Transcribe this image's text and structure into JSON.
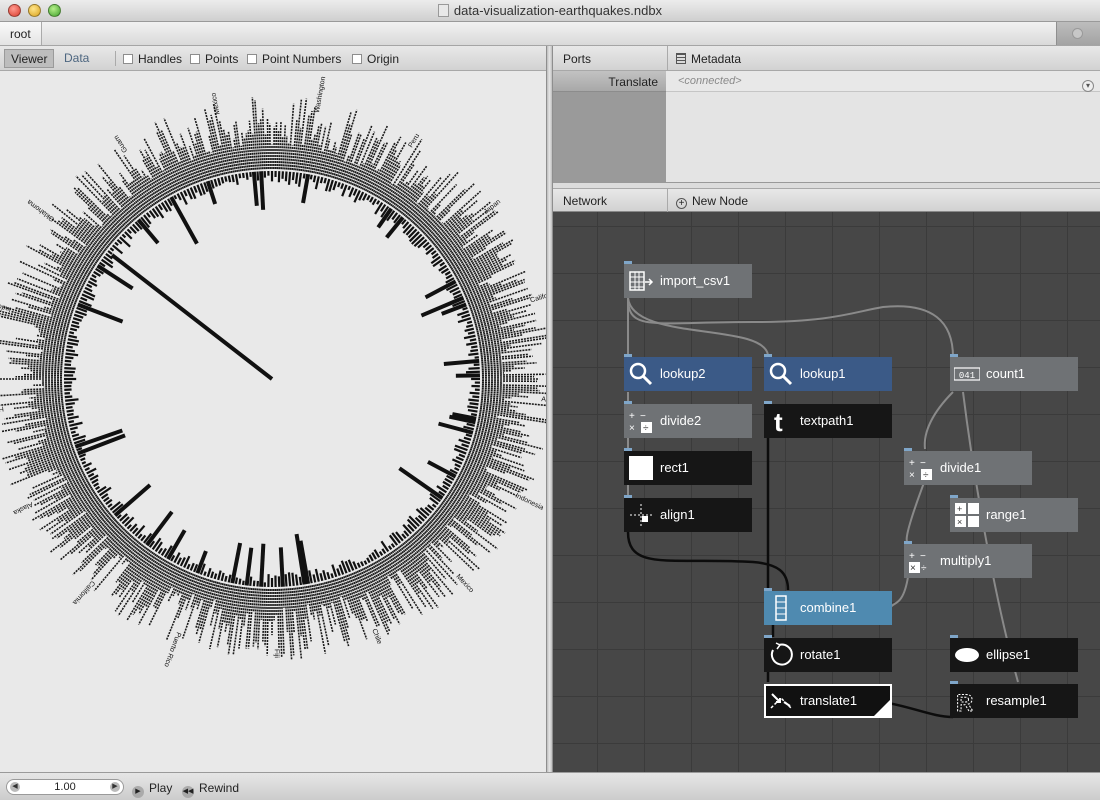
{
  "window": {
    "title": "data-visualization-earthquakes.ndbx"
  },
  "breadcrumb": {
    "root": "root"
  },
  "viewer": {
    "tabs": [
      "Viewer",
      "Data"
    ],
    "options": [
      "Handles",
      "Points",
      "Point Numbers",
      "Origin"
    ],
    "labels_top": [
      "Washington",
      "Peru",
      "Japan",
      "California",
      "Alaska",
      "Indonesia",
      "Mexico",
      "Chile",
      "Fiji"
    ],
    "labels_bottom": [
      "Puerto Rico",
      "California",
      "Alaska",
      "Hawaii",
      "Indonesia",
      "Oklahoma",
      "Guam",
      "Mexico"
    ]
  },
  "ports": {
    "header": "Ports",
    "metadata": "Metadata",
    "rows": [
      {
        "name": "Translate",
        "value": "<connected>"
      }
    ]
  },
  "network": {
    "header": "Network",
    "new_node": "New Node",
    "nodes": {
      "import_csv1": "import_csv1",
      "lookup2": "lookup2",
      "lookup1": "lookup1",
      "count1": "count1",
      "divide2": "divide2",
      "textpath1": "textpath1",
      "rect1": "rect1",
      "divide1": "divide1",
      "align1": "align1",
      "range1": "range1",
      "multiply1": "multiply1",
      "combine1": "combine1",
      "rotate1": "rotate1",
      "ellipse1": "ellipse1",
      "translate1": "translate1",
      "resample1": "resample1"
    }
  },
  "bottom": {
    "frame": "1.00",
    "play": "Play",
    "rewind": "Rewind"
  }
}
